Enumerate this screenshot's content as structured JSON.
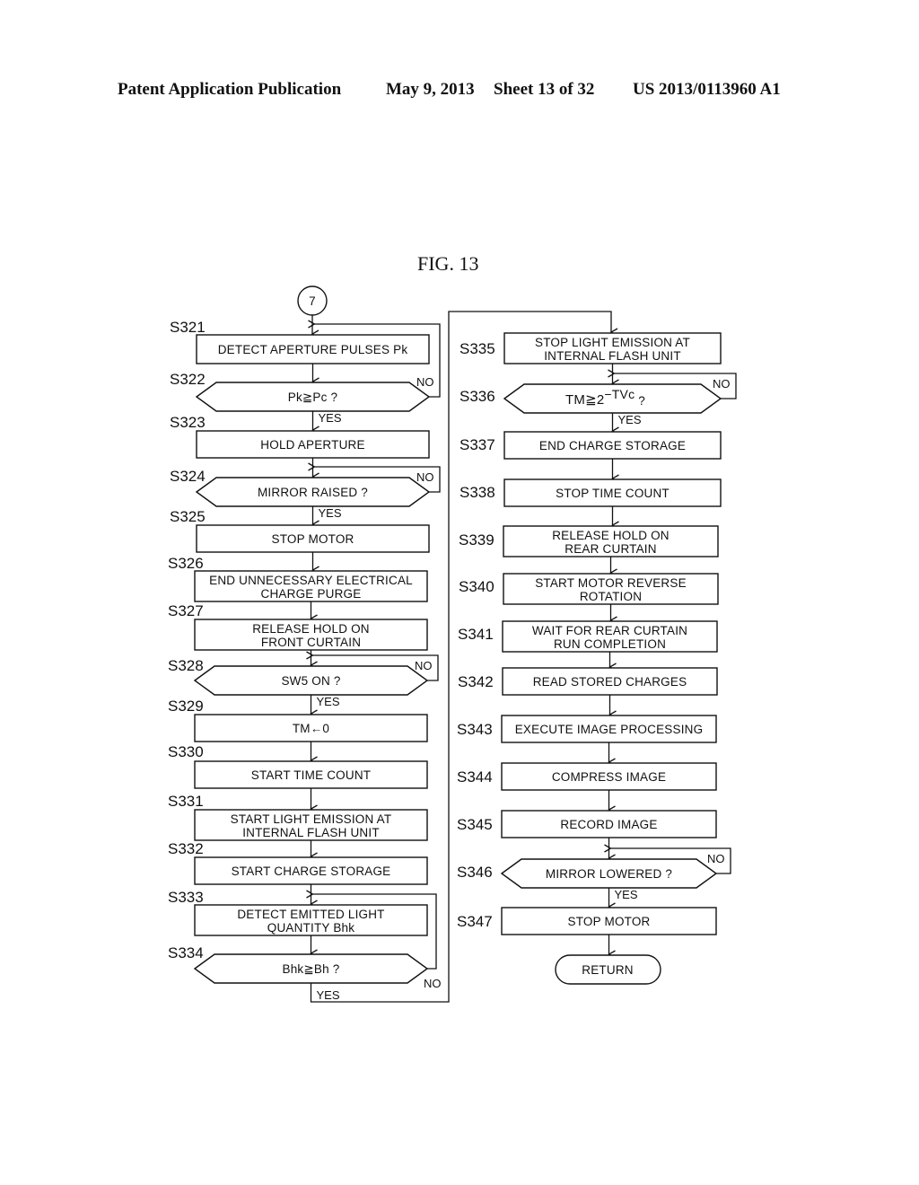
{
  "header": {
    "publication": "Patent Application Publication",
    "date": "May 9, 2013",
    "sheet": "Sheet 13 of 32",
    "number": "US 2013/0113960 A1"
  },
  "figure": {
    "title": "FIG. 13",
    "connector_in": "7",
    "yes_label": "YES",
    "no_label": "NO",
    "terminal": "RETURN"
  },
  "steps": {
    "S321": {
      "id": "S321",
      "type": "process",
      "lines": [
        "DETECT APERTURE PULSES Pk"
      ]
    },
    "S322": {
      "id": "S322",
      "type": "decision",
      "lines": [
        "Pk≧Pc ?"
      ]
    },
    "S323": {
      "id": "S323",
      "type": "process",
      "lines": [
        "HOLD APERTURE"
      ]
    },
    "S324": {
      "id": "S324",
      "type": "decision",
      "lines": [
        "MIRROR RAISED ?"
      ]
    },
    "S325": {
      "id": "S325",
      "type": "process",
      "lines": [
        "STOP MOTOR"
      ]
    },
    "S326": {
      "id": "S326",
      "type": "process",
      "lines": [
        "END UNNECESSARY ELECTRICAL",
        "CHARGE PURGE"
      ]
    },
    "S327": {
      "id": "S327",
      "type": "process",
      "lines": [
        "RELEASE HOLD ON",
        "FRONT CURTAIN"
      ]
    },
    "S328": {
      "id": "S328",
      "type": "decision",
      "lines": [
        "SW5 ON ?"
      ]
    },
    "S329": {
      "id": "S329",
      "type": "process",
      "lines": [
        "TM←0"
      ]
    },
    "S330": {
      "id": "S330",
      "type": "process",
      "lines": [
        "START TIME COUNT"
      ]
    },
    "S331": {
      "id": "S331",
      "type": "process",
      "lines": [
        "START LIGHT EMISSION AT",
        "INTERNAL FLASH UNIT"
      ]
    },
    "S332": {
      "id": "S332",
      "type": "process",
      "lines": [
        "START CHARGE STORAGE"
      ]
    },
    "S333": {
      "id": "S333",
      "type": "process",
      "lines": [
        "DETECT EMITTED LIGHT",
        "QUANTITY Bhk"
      ]
    },
    "S334": {
      "id": "S334",
      "type": "decision",
      "lines": [
        "Bhk≧Bh ?"
      ]
    },
    "S335": {
      "id": "S335",
      "type": "process",
      "lines": [
        "STOP LIGHT EMISSION AT",
        "INTERNAL FLASH UNIT"
      ]
    },
    "S336": {
      "id": "S336",
      "type": "decision",
      "lines": [
        "TM≧2",
        "−TVc",
        " ?"
      ]
    },
    "S337": {
      "id": "S337",
      "type": "process",
      "lines": [
        "END CHARGE STORAGE"
      ]
    },
    "S338": {
      "id": "S338",
      "type": "process",
      "lines": [
        "STOP TIME COUNT"
      ]
    },
    "S339": {
      "id": "S339",
      "type": "process",
      "lines": [
        "RELEASE HOLD ON",
        "REAR CURTAIN"
      ]
    },
    "S340": {
      "id": "S340",
      "type": "process",
      "lines": [
        "START MOTOR REVERSE",
        "ROTATION"
      ]
    },
    "S341": {
      "id": "S341",
      "type": "process",
      "lines": [
        "WAIT FOR REAR CURTAIN",
        "RUN COMPLETION"
      ]
    },
    "S342": {
      "id": "S342",
      "type": "process",
      "lines": [
        "READ STORED CHARGES"
      ]
    },
    "S343": {
      "id": "S343",
      "type": "process",
      "lines": [
        "EXECUTE IMAGE PROCESSING"
      ]
    },
    "S344": {
      "id": "S344",
      "type": "process",
      "lines": [
        "COMPRESS IMAGE"
      ]
    },
    "S345": {
      "id": "S345",
      "type": "process",
      "lines": [
        "RECORD IMAGE"
      ]
    },
    "S346": {
      "id": "S346",
      "type": "decision",
      "lines": [
        "MIRROR LOWERED ?"
      ]
    },
    "S347": {
      "id": "S347",
      "type": "process",
      "lines": [
        "STOP MOTOR"
      ]
    }
  }
}
